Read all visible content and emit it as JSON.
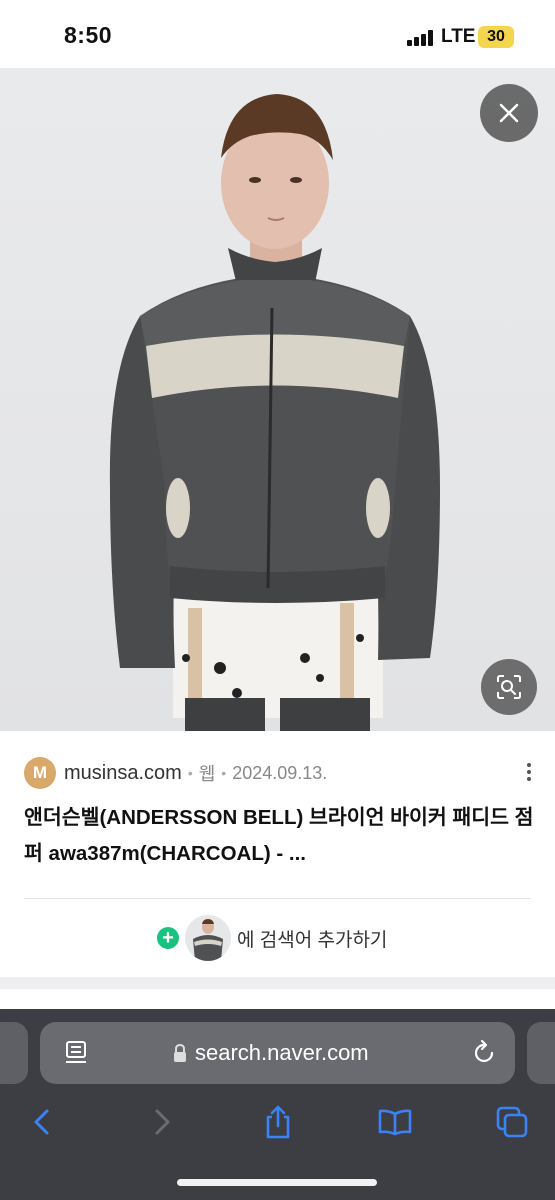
{
  "status_bar": {
    "time": "8:50",
    "network": "LTE",
    "battery": "30"
  },
  "image_viewer": {
    "close_icon": "close-icon",
    "lens_icon": "visual-search-icon",
    "accent": "#4a4a4a"
  },
  "result": {
    "favicon_letter": "M",
    "site": "musinsa.com",
    "type": "웹",
    "date": "2024.09.13.",
    "title": "앤더슨벨(ANDERSSON BELL) 브라이언 바이커 패디드 점퍼 awa387m(CHARCOAL) - ...",
    "add_label": "에 검색어 추가하기",
    "add_color": "#19c27e"
  },
  "browser": {
    "url": "search.naver.com",
    "toolbar": [
      "back-icon",
      "forward-icon",
      "share-icon",
      "bookmarks-icon",
      "tabs-icon"
    ],
    "accent": "#3b82f6"
  }
}
